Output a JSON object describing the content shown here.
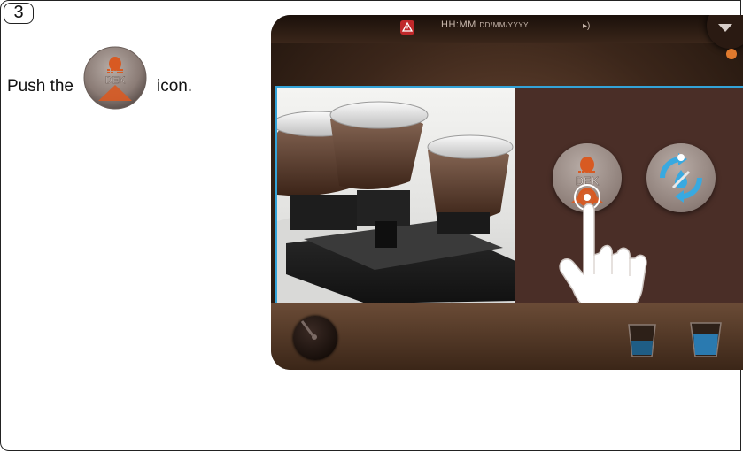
{
  "step": {
    "number": "3"
  },
  "instruction": {
    "before": "Push the",
    "after": "icon."
  },
  "icons": {
    "inline": "dek-button-icon",
    "dek_label": "DEK"
  },
  "screen": {
    "status_bar": {
      "time": "HH:MM",
      "date": "DD/MM/YYYY",
      "warning_icon": "warning-triangle-icon",
      "sound_icon": "speaker-icon",
      "menu_icon": "chevron-down-icon"
    },
    "panel": {
      "buttons": [
        {
          "icon": "dek-icon",
          "label": "DEK"
        },
        {
          "icon": "rinse-cycle-icon"
        }
      ]
    },
    "colors": {
      "accent": "#33a3d8",
      "dek_orange": "#d85a22",
      "panel_bg": "#4a2e27"
    }
  }
}
